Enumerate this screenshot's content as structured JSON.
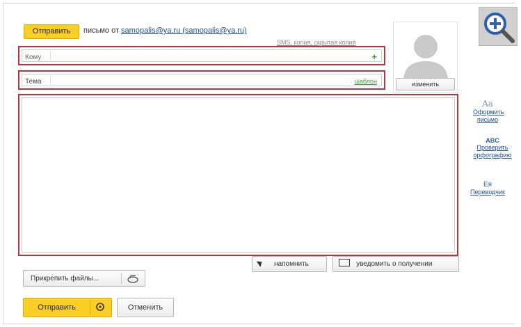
{
  "header": {
    "send_top": "Отправить",
    "from_prefix": "письмо от",
    "from_address": "samopalis@ya.ru (samopalis@ya.ru)",
    "extra_links": "SMS, копия, скрытая копия"
  },
  "to": {
    "label": "Кому",
    "add_icon": "+"
  },
  "subject": {
    "label": "Тема",
    "template_link": "шаблон"
  },
  "avatar": {
    "change_label": "изменить"
  },
  "sidebar": {
    "format_icon": "Aa",
    "format_label": "Оформить письмо",
    "spell_icon": "ABC",
    "spell_label": "Проверить орфографию",
    "translate_icon": "Eя",
    "translate_label": "Переводчик"
  },
  "actions": {
    "remind": "напомнить",
    "notify": "уведомить о получении"
  },
  "attach": {
    "label": "Прикрепить файлы..."
  },
  "footer": {
    "send": "Отправить",
    "cancel": "Отменить"
  },
  "colors": {
    "accent": "#f9cf26",
    "highlight": "#b4373d",
    "link": "#1f4e9c"
  }
}
